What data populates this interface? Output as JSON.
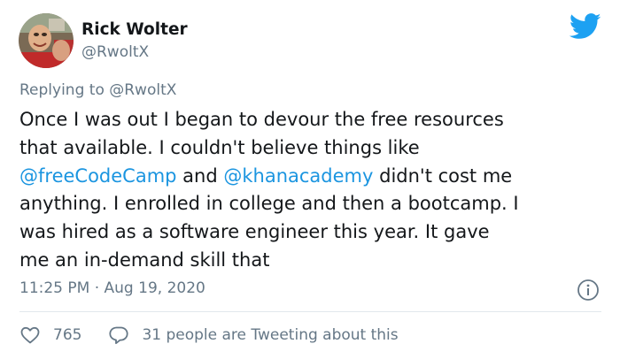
{
  "author": {
    "display_name": "Rick Wolter",
    "handle": "@RwoltX"
  },
  "reply": {
    "prefix": "Replying to",
    "mention": "@RwoltX"
  },
  "tweet": {
    "lines": [
      [
        {
          "text": "Once I was out I began to devour the free resources"
        }
      ],
      [
        {
          "text": "that available. I couldn't believe things like"
        }
      ],
      [
        {
          "text": "@freeCodeCamp",
          "mention": true
        },
        {
          "text": " and "
        },
        {
          "text": "@khanacademy",
          "mention": true
        },
        {
          "text": " didn't cost me"
        }
      ],
      [
        {
          "text": "anything. I enrolled in college and then a bootcamp. I"
        }
      ],
      [
        {
          "text": "was hired as a software engineer this year.  It gave"
        }
      ],
      [
        {
          "text": "me an in-demand skill that"
        }
      ]
    ]
  },
  "meta": {
    "timestamp": "11:25 PM · Aug 19, 2020"
  },
  "actions": {
    "likes": "765",
    "conversation": "31 people are Tweeting about this"
  },
  "colors": {
    "text": "#14171a",
    "secondary": "#657786",
    "link": "#1b95e0",
    "twitter_blue": "#1da1f2",
    "divider": "#e1e8ed"
  },
  "icons": [
    "avatar",
    "twitter-bird-icon",
    "info-icon",
    "heart-icon",
    "reply-bubble-icon"
  ]
}
